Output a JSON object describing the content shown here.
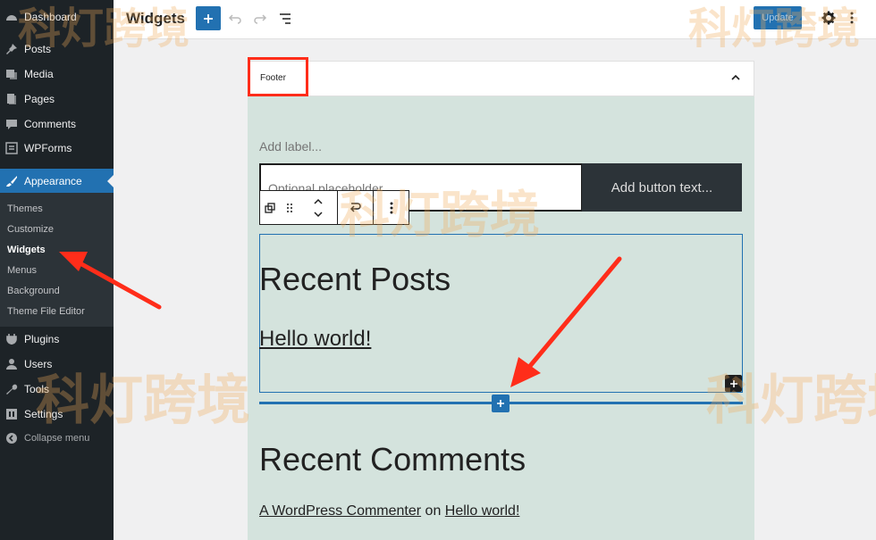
{
  "sidebar": {
    "items": [
      {
        "label": "Dashboard",
        "icon": "dashboard-icon"
      },
      {
        "label": "Posts",
        "icon": "pin-icon"
      },
      {
        "label": "Media",
        "icon": "media-icon"
      },
      {
        "label": "Pages",
        "icon": "pages-icon"
      },
      {
        "label": "Comments",
        "icon": "comment-icon"
      },
      {
        "label": "WPForms",
        "icon": "forms-icon"
      },
      {
        "label": "Appearance",
        "icon": "brush-icon"
      },
      {
        "label": "Plugins",
        "icon": "plugin-icon"
      },
      {
        "label": "Users",
        "icon": "users-icon"
      },
      {
        "label": "Tools",
        "icon": "wrench-icon"
      },
      {
        "label": "Settings",
        "icon": "settings-icon"
      },
      {
        "label": "Collapse menu",
        "icon": "collapse-icon"
      }
    ],
    "submenu": [
      "Themes",
      "Customize",
      "Widgets",
      "Menus",
      "Background",
      "Theme File Editor"
    ]
  },
  "header": {
    "title": "Widgets",
    "update_label": "Update"
  },
  "widget_area": {
    "title": "Footer",
    "search": {
      "label_placeholder": "Add label...",
      "input_placeholder": "Optional placeholder...",
      "button_placeholder": "Add button text..."
    },
    "recent_posts_heading": "Recent Posts",
    "recent_post_link": "Hello world!",
    "recent_comments_heading": "Recent Comments",
    "comment": {
      "author": "A WordPress Commenter",
      "on": "on",
      "post": "Hello world!"
    }
  },
  "watermark": "科灯跨境",
  "colors": {
    "accent": "#2271b1",
    "sidebar_bg": "#1d2327",
    "annotation_red": "#ff2d1a",
    "area_bg": "#d4e3dd"
  }
}
